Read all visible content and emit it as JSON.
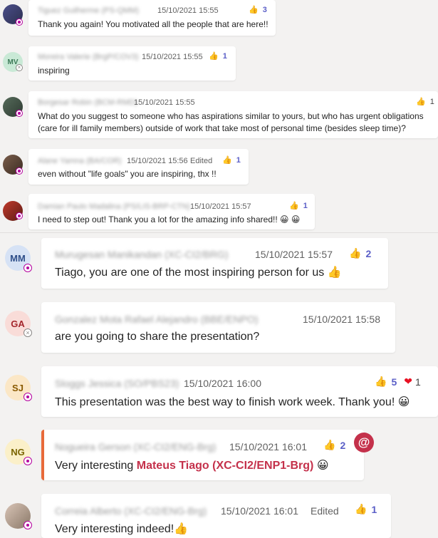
{
  "messages": [
    {
      "sender": "Tiguez Guilherme (PS-QMM)",
      "time": "15/10/2021 15:55",
      "reactions": "3",
      "text": "Thank you again! You motivated all the people that are here!!"
    },
    {
      "initials": "MV",
      "sender": "Moreira Valerie (BrgP/COV3)",
      "time": "15/10/2021 15:55",
      "reactions": "1",
      "text": "inspiring"
    },
    {
      "sender": "Borgesar Robin (BCM-RMD)",
      "time": "15/10/2021 15:55",
      "reactions": "1",
      "text_line1": "What do you suggest to someone who has aspirations similar to yours, but who has urgent obligations",
      "text_line2": "(care for ill family members) outside of work that take most of personal time (besides sleep time)?"
    },
    {
      "sender": "Alane Yamna (BA/COR)",
      "time": "15/10/2021 15:56",
      "edited": "Edited",
      "reactions": "1",
      "text": "even without \"life goals\" you are inspiring, thx !!"
    },
    {
      "sender": "Damian Paulo Madalina (PS/LIS-BRP-CTN)",
      "time": "15/10/2021 15:57",
      "reactions": "1",
      "text": "I need to step out! Thank you a lot for the amazing info shared!!"
    },
    {
      "initials": "MM",
      "sender": "Murugesan Manikandan (XC-CI2/BRG)",
      "time": "15/10/2021 15:57",
      "reactions": "2",
      "text": "Tiago, you are one of the most inspiring person for us"
    },
    {
      "initials": "GA",
      "sender": "Gonzalez Mota Rafael Alejandro (BBE/ENPO)",
      "time": "15/10/2021 15:58",
      "text": "are you going to share the presentation?"
    },
    {
      "initials": "SJ",
      "sender": "Sloggs Jessica (SO/PBS23)",
      "time": "15/10/2021 16:00",
      "reactions": "5",
      "reactions_heart": "1",
      "text": "This presentation was the best way to finish work week. Thank you!"
    },
    {
      "initials": "NG",
      "sender": "Nogueira Gerson (XC-CI2/ENG-Brg)",
      "time": "15/10/2021 16:01",
      "reactions": "2",
      "text_prefix": "Very interesting",
      "mention": "Mateus Tiago (XC-CI2/ENP1-Brg)",
      "at_symbol": "@"
    },
    {
      "sender": "Correia Alberto (XC-CI2/ENG-Brg)",
      "time": "15/10/2021 16:01",
      "edited": "Edited",
      "reactions": "1",
      "text": "Very interesting indeed!"
    }
  ],
  "icons": {
    "thumbs_up": "👍",
    "heart": "❤",
    "smile": "😀",
    "status_oof": "out-of-office-status-icon",
    "status_offline": "offline-status-icon"
  },
  "colors": {
    "accent": "#5b5fc7",
    "mention": "#c4314b",
    "mention_bar": "#e86a3a",
    "oof": "#b4009e"
  }
}
